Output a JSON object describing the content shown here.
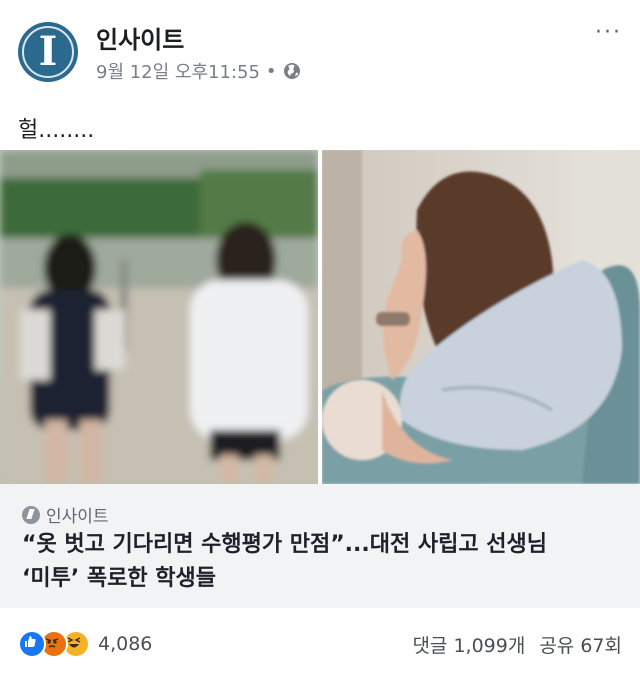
{
  "post": {
    "page_name": "인사이트",
    "avatar_letter": "I",
    "timestamp": "9월 12일 오후11:55",
    "separator": "•",
    "privacy_icon": "globe-icon",
    "more_label": "···",
    "caption": "헐........"
  },
  "link": {
    "source": "인사이트",
    "source_icon": "instant-article-bolt-icon",
    "headline_line1": "“옷 벗고 기다리면 수행평가 만점”...대전 사립고 선생님",
    "headline_line2": "‘미투’ 폭로한 학생들"
  },
  "footer": {
    "reaction_icons": [
      "like-icon",
      "angry-icon",
      "haha-icon"
    ],
    "reaction_count": "4,086",
    "comments": "댓글 1,099개",
    "shares": "공유 67회"
  },
  "colors": {
    "brand_blue": "#2b6a8e",
    "like_blue": "#1877f2",
    "meta_gray": "#7a7f87",
    "card_bg": "#f2f3f5"
  }
}
